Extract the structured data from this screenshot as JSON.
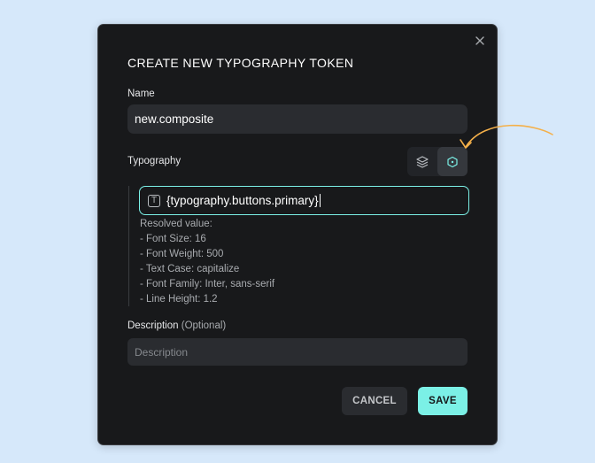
{
  "dialog": {
    "title": "CREATE NEW TYPOGRAPHY TOKEN",
    "close_icon": "close-icon"
  },
  "name_field": {
    "label": "Name",
    "value": "new.composite"
  },
  "typography": {
    "label": "Typography",
    "modes": [
      {
        "icon": "layers-icon",
        "active": false
      },
      {
        "icon": "hexagon-reference-icon",
        "active": true
      }
    ],
    "reference_value": "{typography.buttons.primary}",
    "reference_icon": "text-type-icon",
    "resolved_title": "Resolved value:",
    "resolved_lines": [
      "- Font Size: 16",
      "- Font Weight: 500",
      "- Text Case: capitalize",
      "- Font Family: Inter, sans-serif",
      "- Line Height: 1.2"
    ]
  },
  "description": {
    "label": "Description",
    "optional": "(Optional)",
    "placeholder": "Description"
  },
  "buttons": {
    "cancel": "CANCEL",
    "save": "SAVE"
  },
  "colors": {
    "accent": "#7bf0e6",
    "annotation_arrow": "#f4b04a",
    "dialog_bg": "#18191b",
    "page_bg": "#d6e8fa"
  }
}
